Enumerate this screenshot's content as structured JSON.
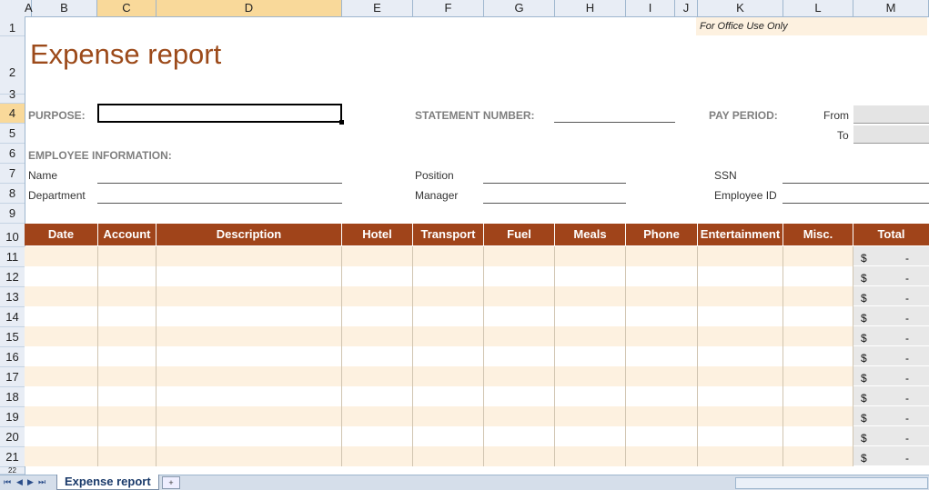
{
  "columns": [
    "A",
    "B",
    "C",
    "D",
    "E",
    "F",
    "G",
    "H",
    "I",
    "J",
    "K",
    "L",
    "M"
  ],
  "rows": [
    "1",
    "2",
    "3",
    "4",
    "5",
    "6",
    "7",
    "8",
    "9",
    "10",
    "11",
    "12",
    "13",
    "14",
    "15",
    "16",
    "17",
    "18",
    "19",
    "20",
    "21",
    "22"
  ],
  "title": "Expense report",
  "office_use": "For Office Use Only",
  "labels": {
    "purpose": "PURPOSE:",
    "statement_number": "STATEMENT NUMBER:",
    "pay_period": "PAY PERIOD:",
    "from": "From",
    "to": "To",
    "employee_information": "EMPLOYEE INFORMATION:",
    "name": "Name",
    "department": "Department",
    "position": "Position",
    "manager": "Manager",
    "ssn": "SSN",
    "employee_id": "Employee ID"
  },
  "table_headers": [
    "Date",
    "Account",
    "Description",
    "Hotel",
    "Transport",
    "Fuel",
    "Meals",
    "Phone",
    "Entertainment",
    "Misc.",
    "Total"
  ],
  "total_rows": [
    {
      "currency": "$",
      "value": "-"
    },
    {
      "currency": "$",
      "value": "-"
    },
    {
      "currency": "$",
      "value": "-"
    },
    {
      "currency": "$",
      "value": "-"
    },
    {
      "currency": "$",
      "value": "-"
    },
    {
      "currency": "$",
      "value": "-"
    },
    {
      "currency": "$",
      "value": "-"
    },
    {
      "currency": "$",
      "value": "-"
    },
    {
      "currency": "$",
      "value": "-"
    },
    {
      "currency": "$",
      "value": "-"
    },
    {
      "currency": "$",
      "value": "-"
    }
  ],
  "sheet_tab": "Expense report",
  "colors": {
    "header_fill": "#a0441a",
    "title": "#9c4a1a",
    "band": "#fdf1e0"
  }
}
